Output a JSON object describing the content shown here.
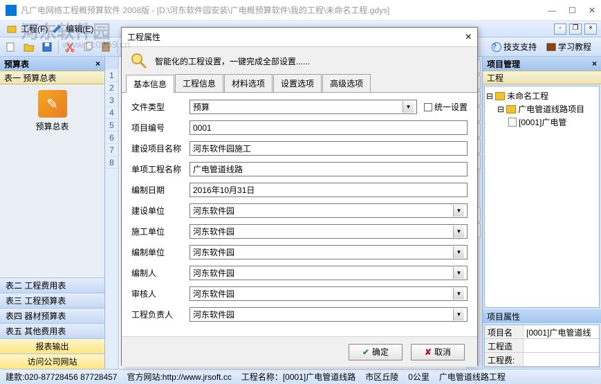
{
  "titlebar": {
    "text": "凡广电网络工程概预算软件 2008版 - [D:\\河东软件园安装\\广电概预算软件\\我的工程\\未命名工程.gdys]"
  },
  "watermark": {
    "main": "河东软件园",
    "sub": "www.pc0359.cn"
  },
  "menubar": {
    "project": "工程(F)",
    "edit": "编辑(E)"
  },
  "toolbar_right": {
    "tech": "技支支持",
    "learn": "学习教程"
  },
  "left_panel": {
    "title": "预算表",
    "section": "表一 预算总表",
    "icon_label": "预算总表",
    "items": [
      "表二 工程费用表",
      "表三 工程预算表",
      "表四 器材预算表",
      "表五 其他费用表",
      "报表输出",
      "访问公司网站"
    ]
  },
  "gutter_rows": [
    "1",
    "2",
    "3",
    "4",
    "5",
    "6",
    "7",
    "8"
  ],
  "right_panel": {
    "title": "项目管理",
    "section": "工程",
    "tree": {
      "root": "未命名工程",
      "child": "广电管道线路项目",
      "leaf": "[0001]广电管"
    },
    "prop_title": "项目属性",
    "props": [
      {
        "label": "项目名称:",
        "value": "[0001]广电管道线"
      },
      {
        "label": "工程造价:",
        "value": ""
      },
      {
        "label": "工程费:",
        "value": ""
      }
    ]
  },
  "status": {
    "phone": "建款:020-87728456 87728457",
    "site": "官方网站:http://www.jrsoft.cc",
    "proj": "工程名称：[0001]广电管道线路",
    "area": "市区丘陵",
    "dist": "0公里",
    "type": "广电管道线路工程"
  },
  "dialog": {
    "title": "工程属性",
    "banner": "智能化的工程设置，一键完成全部设置......",
    "tabs": [
      "基本信息",
      "工程信息",
      "材料选项",
      "设置选项",
      "高级选项"
    ],
    "chk_label": "统一设置",
    "fields": {
      "file_type": {
        "label": "文件类型",
        "value": "预算"
      },
      "proj_no": {
        "label": "项目编号",
        "value": "0001"
      },
      "build_name": {
        "label": "建设项目名称",
        "value": "河东软件园施工"
      },
      "single_name": {
        "label": "单项工程名称",
        "value": "广电管道线路"
      },
      "date": {
        "label": "编制日期",
        "value": "2016年10月31日"
      },
      "build_unit": {
        "label": "建设单位",
        "value": "河东软件园"
      },
      "construct_unit": {
        "label": "施工单位",
        "value": "河东软件园"
      },
      "compile_unit": {
        "label": "编制单位",
        "value": "河东软件园"
      },
      "compiler": {
        "label": "编制人",
        "value": "河东软件园"
      },
      "reviewer": {
        "label": "审核人",
        "value": "河东软件园"
      },
      "leader": {
        "label": "工程负责人",
        "value": "河东软件园"
      }
    },
    "ok": "确定",
    "cancel": "取消"
  }
}
